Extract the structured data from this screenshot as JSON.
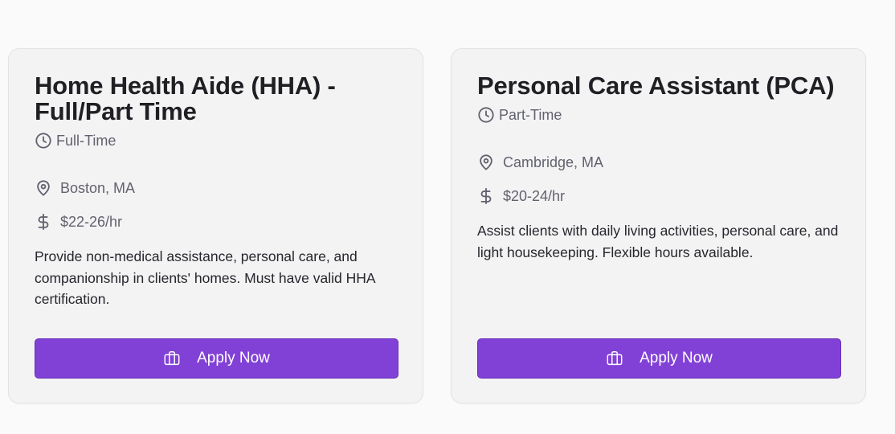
{
  "jobs": [
    {
      "title": "Home Health Aide (HHA) - Full/Part Time",
      "type": "Full-Time",
      "location": "Boston, MA",
      "pay": "$22-26/hr",
      "description": "Provide non-medical assistance, personal care, and companionship in clients' homes. Must have valid HHA certification.",
      "apply_label": "Apply Now"
    },
    {
      "title": "Personal Care Assistant (PCA)",
      "type": "Part-Time",
      "location": "Cambridge, MA",
      "pay": "$20-24/hr",
      "description": "Assist clients with daily living activities, personal care, and light housekeeping. Flexible hours available.",
      "apply_label": "Apply Now"
    }
  ],
  "icons": {
    "type": "clock-icon",
    "location": "map-pin-icon",
    "pay": "dollar-icon",
    "apply": "briefcase-icon"
  },
  "colors": {
    "accent": "#8241d6",
    "muted_text": "#62626e",
    "card_bg": "#f3f3f4",
    "page_bg": "#fafafa"
  }
}
